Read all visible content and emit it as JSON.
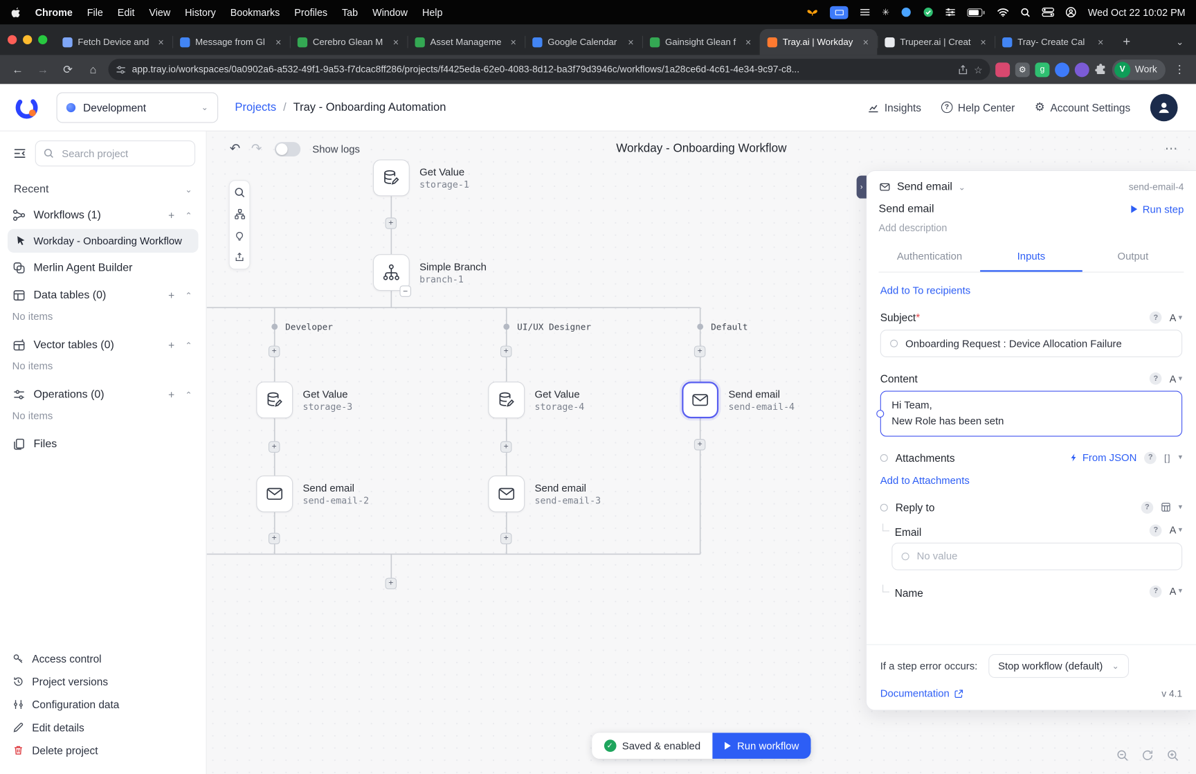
{
  "menubar": {
    "menus": [
      "Chrome",
      "File",
      "Edit",
      "View",
      "History",
      "Bookmarks",
      "Profiles",
      "Tab",
      "Window",
      "Help"
    ],
    "clock": "Wed Oct 22 10:02 PM"
  },
  "browser": {
    "tabs": [
      {
        "label": "Fetch Device and",
        "color": "#7ea6f7"
      },
      {
        "label": "Message from Gl",
        "color": "#4285f4"
      },
      {
        "label": "Cerebro Glean M",
        "color": "#34a853"
      },
      {
        "label": "Asset Manageme",
        "color": "#34a853"
      },
      {
        "label": "Google Calendar",
        "color": "#4285f4"
      },
      {
        "label": "Gainsight Glean f",
        "color": "#34a853"
      },
      {
        "label": "Tray.ai | Workday",
        "color": "#ff7a30"
      },
      {
        "label": "Trupeer.ai | Creat",
        "color": "#e8eaed"
      },
      {
        "label": "Tray- Create Cal",
        "color": "#4285f4"
      }
    ],
    "url": "app.tray.io/workspaces/0a0902a6-a532-49f1-9a53-f7dcac8ff286/projects/f4425eda-62e0-4083-8d12-ba3f79d3946c/workflows/1a28ce6d-4c61-4e34-9c97-c8...",
    "profile": {
      "initial": "V",
      "label": "Work"
    }
  },
  "header": {
    "workspace": "Development",
    "breadcrumb": {
      "link": "Projects",
      "separator": "/",
      "current": "Tray - Onboarding Automation"
    },
    "nav": {
      "insights": "Insights",
      "help": "Help Center",
      "settings": "Account Settings"
    }
  },
  "sidebar": {
    "search_placeholder": "Search project",
    "recent": "Recent",
    "workflows": {
      "label": "Workflows (1)",
      "selected": "Workday - Onboarding Workflow",
      "agent": "Merlin Agent Builder"
    },
    "data_tables": {
      "label": "Data tables (0)",
      "empty": "No items"
    },
    "vector_tables": {
      "label": "Vector tables (0)",
      "empty": "No items"
    },
    "operations": {
      "label": "Operations (0)",
      "empty": "No items"
    },
    "files": "Files",
    "footer": {
      "access": "Access control",
      "versions": "Project versions",
      "config": "Configuration data",
      "edit": "Edit details",
      "delete": "Delete project"
    }
  },
  "canvas": {
    "show_logs": "Show logs",
    "title": "Workday - Onboarding Workflow",
    "branches": [
      "Developer",
      "UI/UX Designer",
      "Default"
    ],
    "nodes": {
      "storage1": {
        "title": "Get Value",
        "subtitle": "storage-1"
      },
      "branch1": {
        "title": "Simple Branch",
        "subtitle": "branch-1"
      },
      "storage3": {
        "title": "Get Value",
        "subtitle": "storage-3"
      },
      "storage4": {
        "title": "Get Value",
        "subtitle": "storage-4"
      },
      "email4": {
        "title": "Send email",
        "subtitle": "send-email-4"
      },
      "email2": {
        "title": "Send email",
        "subtitle": "send-email-2"
      },
      "email3": {
        "title": "Send email",
        "subtitle": "send-email-3"
      }
    },
    "status": {
      "saved": "Saved & enabled",
      "run": "Run workflow"
    }
  },
  "panel": {
    "connector": "Send email",
    "step_id": "send-email-4",
    "title": "Send email",
    "run_step": "Run step",
    "description": "Add description",
    "tabs": [
      "Authentication",
      "Inputs",
      "Output"
    ],
    "add_recipients": "Add to To recipients",
    "subject": {
      "label": "Subject",
      "required": "*",
      "value": "Onboarding Request : Device Allocation Failure"
    },
    "content": {
      "label": "Content",
      "line1": "Hi Team,",
      "line2": "New Role has been setn"
    },
    "attachments": {
      "label": "Attachments",
      "from_json": "From JSON",
      "add": "Add to Attachments"
    },
    "reply_to": {
      "label": "Reply to",
      "email_label": "Email",
      "email_placeholder": "No value",
      "name_label": "Name"
    },
    "error": {
      "label": "If a step error occurs:",
      "value": "Stop workflow (default)"
    },
    "documentation": "Documentation",
    "version": "v 4.1"
  },
  "colors": {
    "accent": "#2d5ef5",
    "selected_node": "#575df0",
    "saved_green": "#1ea55d",
    "delete_red": "#de3b40"
  }
}
